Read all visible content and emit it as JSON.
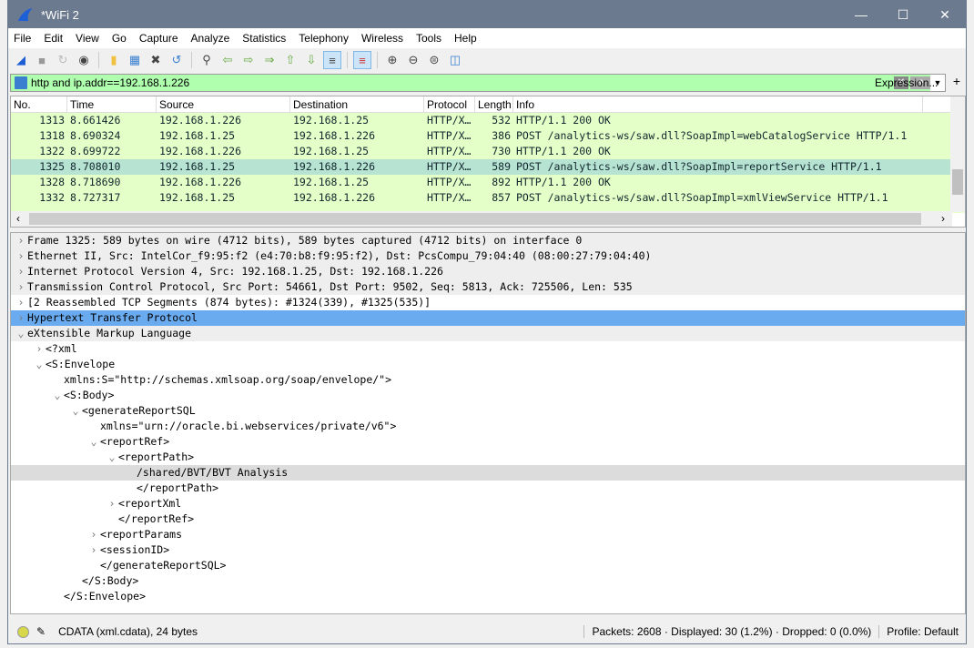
{
  "window": {
    "title": "*WiFi 2"
  },
  "menu": [
    "File",
    "Edit",
    "View",
    "Go",
    "Capture",
    "Analyze",
    "Statistics",
    "Telephony",
    "Wireless",
    "Tools",
    "Help"
  ],
  "toolbar": [
    "shark-fin-start",
    "stop",
    "restart",
    "options",
    "open",
    "save",
    "close",
    "reload",
    "find",
    "back",
    "forward",
    "go-to",
    "first",
    "last",
    "autoscroll",
    "colorize",
    "zoom-in",
    "zoom-out",
    "zoom-normal",
    "resize-columns"
  ],
  "filter": {
    "value": "http and ip.addr==192.168.1.226",
    "expression_label": "Expression...",
    "plus": "+",
    "bg_color": "#afffaf"
  },
  "packet_list": {
    "columns": [
      "No.",
      "Time",
      "Source",
      "Destination",
      "Protocol",
      "Length",
      "Info"
    ],
    "rows": [
      [
        "1313",
        "8.661426",
        "192.168.1.226",
        "192.168.1.25",
        "HTTP/X…",
        "532",
        "HTTP/1.1 200 OK"
      ],
      [
        "1318",
        "8.690324",
        "192.168.1.25",
        "192.168.1.226",
        "HTTP/X…",
        "386",
        "POST /analytics-ws/saw.dll?SoapImpl=webCatalogService HTTP/1.1"
      ],
      [
        "1322",
        "8.699722",
        "192.168.1.226",
        "192.168.1.25",
        "HTTP/X…",
        "730",
        "HTTP/1.1 200 OK"
      ],
      [
        "1325",
        "8.708010",
        "192.168.1.25",
        "192.168.1.226",
        "HTTP/X…",
        "589",
        "POST /analytics-ws/saw.dll?SoapImpl=reportService HTTP/1.1"
      ],
      [
        "1328",
        "8.718690",
        "192.168.1.226",
        "192.168.1.25",
        "HTTP/X…",
        "892",
        "HTTP/1.1 200 OK"
      ],
      [
        "1332",
        "8.727317",
        "192.168.1.25",
        "192.168.1.226",
        "HTTP/X…",
        "857",
        "POST /analytics-ws/saw.dll?SoapImpl=xmlViewService HTTP/1.1"
      ]
    ],
    "selected": "1325"
  },
  "details": [
    {
      "indent": 0,
      "arrow": ">",
      "text": "Frame 1325: 589 bytes on wire (4712 bits), 589 bytes captured (4712 bits) on interface 0",
      "style": "g"
    },
    {
      "indent": 0,
      "arrow": ">",
      "text": "Ethernet II, Src: IntelCor_f9:95:f2 (e4:70:b8:f9:95:f2), Dst: PcsCompu_79:04:40 (08:00:27:79:04:40)",
      "style": "g"
    },
    {
      "indent": 0,
      "arrow": ">",
      "text": "Internet Protocol Version 4, Src: 192.168.1.25, Dst: 192.168.1.226",
      "style": "g"
    },
    {
      "indent": 0,
      "arrow": ">",
      "text": "Transmission Control Protocol, Src Port: 54661, Dst Port: 9502, Seq: 5813, Ack: 725506, Len: 535",
      "style": "g"
    },
    {
      "indent": 0,
      "arrow": ">",
      "text": "[2 Reassembled TCP Segments (874 bytes): #1324(339), #1325(535)]",
      "style": ""
    },
    {
      "indent": 0,
      "arrow": ">",
      "text": "Hypertext Transfer Protocol",
      "style": "hl"
    },
    {
      "indent": 0,
      "arrow": "v",
      "text": "eXtensible Markup Language",
      "style": "g"
    },
    {
      "indent": 1,
      "arrow": ">",
      "text": "<?xml",
      "style": ""
    },
    {
      "indent": 1,
      "arrow": "v",
      "text": "<S:Envelope",
      "style": ""
    },
    {
      "indent": 2,
      "arrow": "",
      "text": "xmlns:S=\"http://schemas.xmlsoap.org/soap/envelope/\">",
      "style": ""
    },
    {
      "indent": 2,
      "arrow": "v",
      "text": "<S:Body>",
      "style": ""
    },
    {
      "indent": 3,
      "arrow": "v",
      "text": "<generateReportSQL",
      "style": ""
    },
    {
      "indent": 4,
      "arrow": "",
      "text": "xmlns=\"urn://oracle.bi.webservices/private/v6\">",
      "style": ""
    },
    {
      "indent": 4,
      "arrow": "v",
      "text": "<reportRef>",
      "style": ""
    },
    {
      "indent": 5,
      "arrow": "v",
      "text": "<reportPath>",
      "style": ""
    },
    {
      "indent": 6,
      "arrow": "",
      "text": "/shared/BVT/BVT Analysis",
      "style": "xs"
    },
    {
      "indent": 6,
      "arrow": "",
      "text": "</reportPath>",
      "style": ""
    },
    {
      "indent": 5,
      "arrow": ">",
      "text": "<reportXml",
      "style": ""
    },
    {
      "indent": 5,
      "arrow": "",
      "text": "</reportRef>",
      "style": ""
    },
    {
      "indent": 4,
      "arrow": ">",
      "text": "<reportParams",
      "style": ""
    },
    {
      "indent": 4,
      "arrow": ">",
      "text": "<sessionID>",
      "style": ""
    },
    {
      "indent": 4,
      "arrow": "",
      "text": "</generateReportSQL>",
      "style": ""
    },
    {
      "indent": 3,
      "arrow": "",
      "text": "</S:Body>",
      "style": ""
    },
    {
      "indent": 2,
      "arrow": "",
      "text": "</S:Envelope>",
      "style": ""
    }
  ],
  "status": {
    "field": "CDATA (xml.cdata), 24 bytes",
    "packets": "Packets: 2608 · Displayed: 30 (1.2%) · Dropped: 0 (0.0%)",
    "profile": "Profile: Default"
  }
}
